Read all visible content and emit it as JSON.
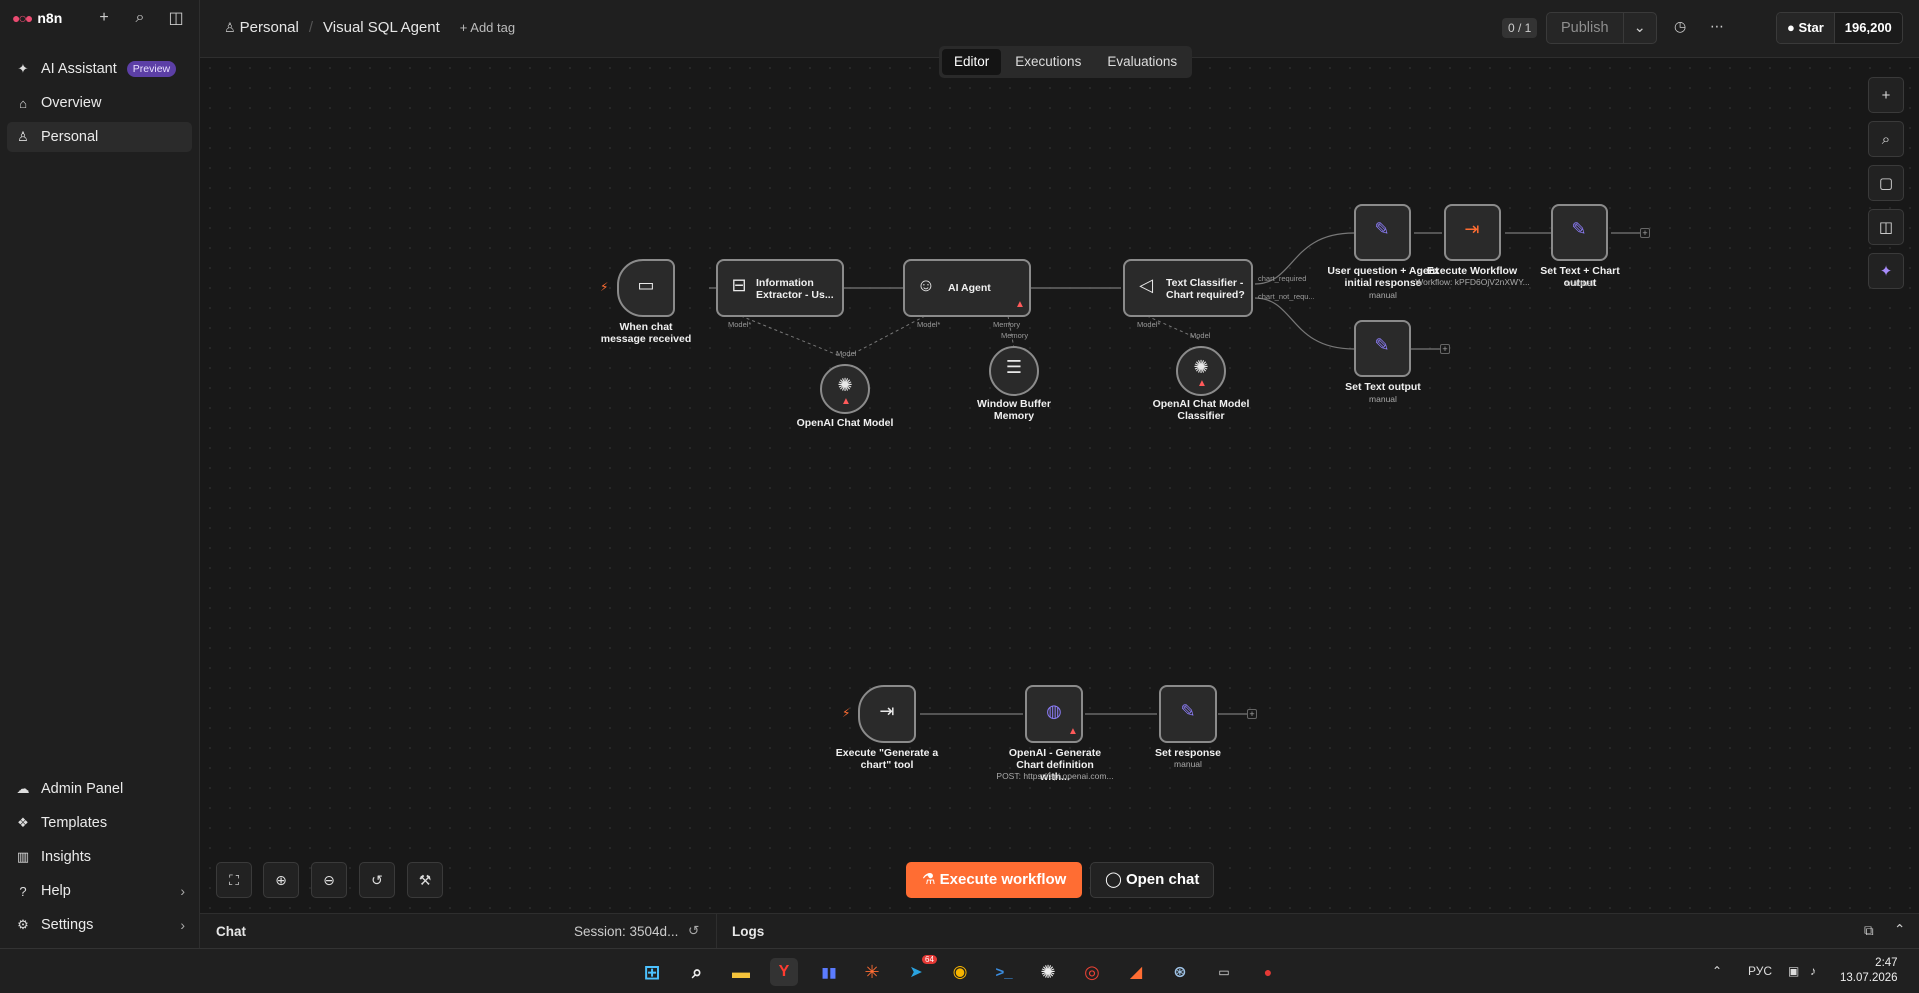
{
  "sidebar": {
    "brand": "n8n",
    "items": [
      {
        "label": "AI Assistant",
        "badge": "Preview"
      },
      {
        "label": "Overview"
      },
      {
        "label": "Personal"
      }
    ],
    "bottom_items": [
      {
        "label": "Admin Panel"
      },
      {
        "label": "Templates"
      },
      {
        "label": "Insights"
      },
      {
        "label": "Help"
      },
      {
        "label": "Settings"
      }
    ]
  },
  "header": {
    "project": "Personal",
    "workflow_name": "Visual SQL Agent",
    "add_tag": "+ Add tag",
    "counter": "0 / 1",
    "publish": "Publish",
    "github_star": "Star",
    "github_count": "196,200"
  },
  "tabs": [
    "Editor",
    "Executions",
    "Evaluations"
  ],
  "nodes": {
    "chat_trigger": "When chat message received",
    "info_extractor": "Information Extractor - Us...",
    "ai_agent": "AI Agent",
    "text_classifier": "Text Classifier - Chart required?",
    "user_question": "User question + Agent initial response",
    "user_question_sub": "manual",
    "execute_workflow": "Execute Workflow",
    "execute_workflow_sub": "Workflow: kPFD6OjV2nXWY...",
    "set_text_chart": "Set Text + Chart output",
    "set_text_chart_sub": "manual",
    "set_text_output": "Set Text output",
    "set_text_output_sub": "manual",
    "openai_model": "OpenAI Chat Model",
    "window_memory": "Window Buffer Memory",
    "openai_classifier": "OpenAI Chat Model Classifier",
    "exec_tool": "Execute \"Generate a chart\" tool",
    "openai_generate": "OpenAI - Generate Chart definition with...",
    "openai_generate_sub": "POST: https://api.openai.com...",
    "set_response": "Set response",
    "set_response_sub": "manual"
  },
  "ports": {
    "model": "Model*",
    "model_plain": "Model",
    "memory": "Memory",
    "chart_required": "chart_required",
    "chart_not_required": "chart_not_requ..."
  },
  "buttons": {
    "execute_workflow": "Execute workflow",
    "open_chat": "Open chat"
  },
  "bottom_panel": {
    "chat": "Chat",
    "session": "Session: 3504d...",
    "logs": "Logs"
  },
  "taskbar": {
    "language": "РУС",
    "time": "2:47",
    "date": "13.07.2026",
    "telegram_badge": "64"
  }
}
